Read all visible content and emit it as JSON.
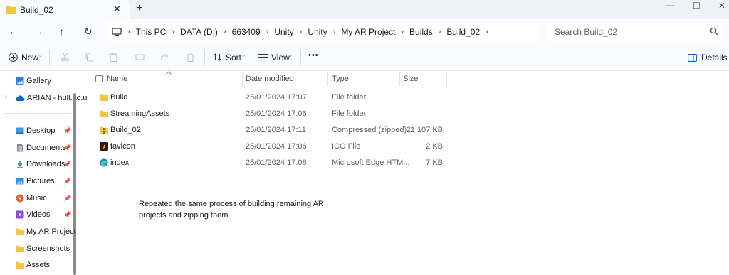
{
  "window": {
    "tab_title": "Build_02",
    "tab_close": "✕",
    "new_tab": "+",
    "minimize": "—",
    "maximize": "☐",
    "close": "✕"
  },
  "nav": {
    "back": "←",
    "forward": "→",
    "up": "↑",
    "refresh": "↻",
    "breadcrumbs": [
      "This PC",
      "DATA (D:)",
      "663409",
      "Unity",
      "Unity",
      "My AR Project",
      "Builds",
      "Build_02"
    ],
    "separator": "›",
    "search_placeholder": "Search Build_02"
  },
  "toolbar": {
    "new_label": "New",
    "sort_label": "Sort",
    "view_label": "View",
    "more_label": "•••",
    "details_label": "Details",
    "chevron": "⌄"
  },
  "sidebar": {
    "items": [
      {
        "label": "Gallery",
        "icon": "gallery-icon",
        "pinned": false
      },
      {
        "label": "ARIAN - hull.ac.u",
        "icon": "cloud-icon",
        "pinned": false
      },
      {
        "label": "Desktop",
        "icon": "desktop-icon",
        "pinned": true
      },
      {
        "label": "Documents",
        "icon": "documents-icon",
        "pinned": true
      },
      {
        "label": "Downloads",
        "icon": "downloads-icon",
        "pinned": true
      },
      {
        "label": "Pictures",
        "icon": "pictures-icon",
        "pinned": true
      },
      {
        "label": "Music",
        "icon": "music-icon",
        "pinned": true
      },
      {
        "label": "Videos",
        "icon": "videos-icon",
        "pinned": true
      },
      {
        "label": "My AR Project",
        "icon": "folder-icon",
        "pinned": false
      },
      {
        "label": "Screenshots",
        "icon": "folder-icon",
        "pinned": false
      },
      {
        "label": "Assets",
        "icon": "folder-icon",
        "pinned": false
      }
    ],
    "pin_glyph": "📌",
    "expander": "›"
  },
  "columns": {
    "name": "Name",
    "date": "Date modified",
    "type": "Type",
    "size": "Size"
  },
  "files": [
    {
      "name": "Build",
      "date": "25/01/2024 17:07",
      "type": "File folder",
      "size": "",
      "icon": "folder-icon"
    },
    {
      "name": "StreamingAssets",
      "date": "25/01/2024 17:06",
      "type": "File folder",
      "size": "",
      "icon": "folder-icon"
    },
    {
      "name": "Build_02",
      "date": "25/01/2024 17:11",
      "type": "Compressed (zipped)...",
      "size": "21,107 KB",
      "icon": "zip-icon"
    },
    {
      "name": "favicon",
      "date": "25/01/2024 17:06",
      "type": "ICO File",
      "size": "2 KB",
      "icon": "favicon-icon"
    },
    {
      "name": "index",
      "date": "25/01/2024 17:08",
      "type": "Microsoft Edge HTM...",
      "size": "7 KB",
      "icon": "edge-icon"
    }
  ],
  "note": "Repeated the same process of building remaining AR projects and zipping them.",
  "colors": {
    "folder": "#f4c542",
    "accent": "#0a64c8"
  }
}
